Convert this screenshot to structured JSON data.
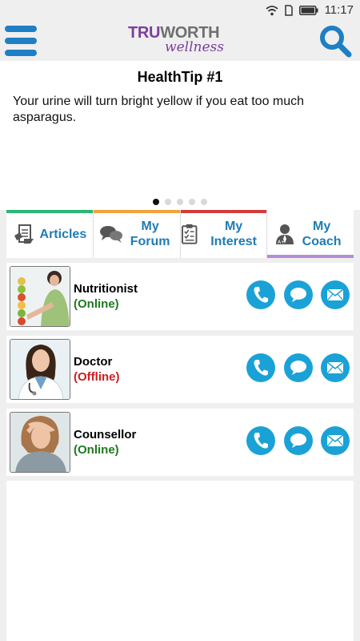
{
  "statusbar": {
    "time": "11:17",
    "icons": [
      "wifi-icon",
      "sim-icon",
      "battery-icon"
    ]
  },
  "header": {
    "logo_tru": "TRU",
    "logo_worth": "WORTH",
    "logo_sub": "wellness",
    "brand_purple": "#7b3f9e",
    "accent_blue": "#1e7fc4"
  },
  "tip": {
    "title": "HealthTip #1",
    "body": "Your urine will turn bright yellow if you eat too much asparagus.",
    "pages": 5,
    "active_page": 1
  },
  "tabs": [
    {
      "label": "Articles",
      "icon": "articles-icon",
      "color": "#2bb673"
    },
    {
      "label": "My Forum",
      "icon": "forum-icon",
      "color": "#f0a23b"
    },
    {
      "label": "My Interest",
      "icon": "clipboard-icon",
      "color": "#d63b3b"
    },
    {
      "label": "My Coach",
      "icon": "coach-icon",
      "color": "#b48cd6",
      "active": true
    }
  ],
  "coaches": [
    {
      "role": "Nutritionist",
      "status": "(Online)",
      "status_color": "#1f7a1f"
    },
    {
      "role": "Doctor",
      "status": "(Offline)",
      "status_color": "#cc1f1f"
    },
    {
      "role": "Counsellor",
      "status": "(Online)",
      "status_color": "#1f7a1f"
    }
  ],
  "action_icons": [
    "phone-icon",
    "chat-icon",
    "mail-icon"
  ]
}
